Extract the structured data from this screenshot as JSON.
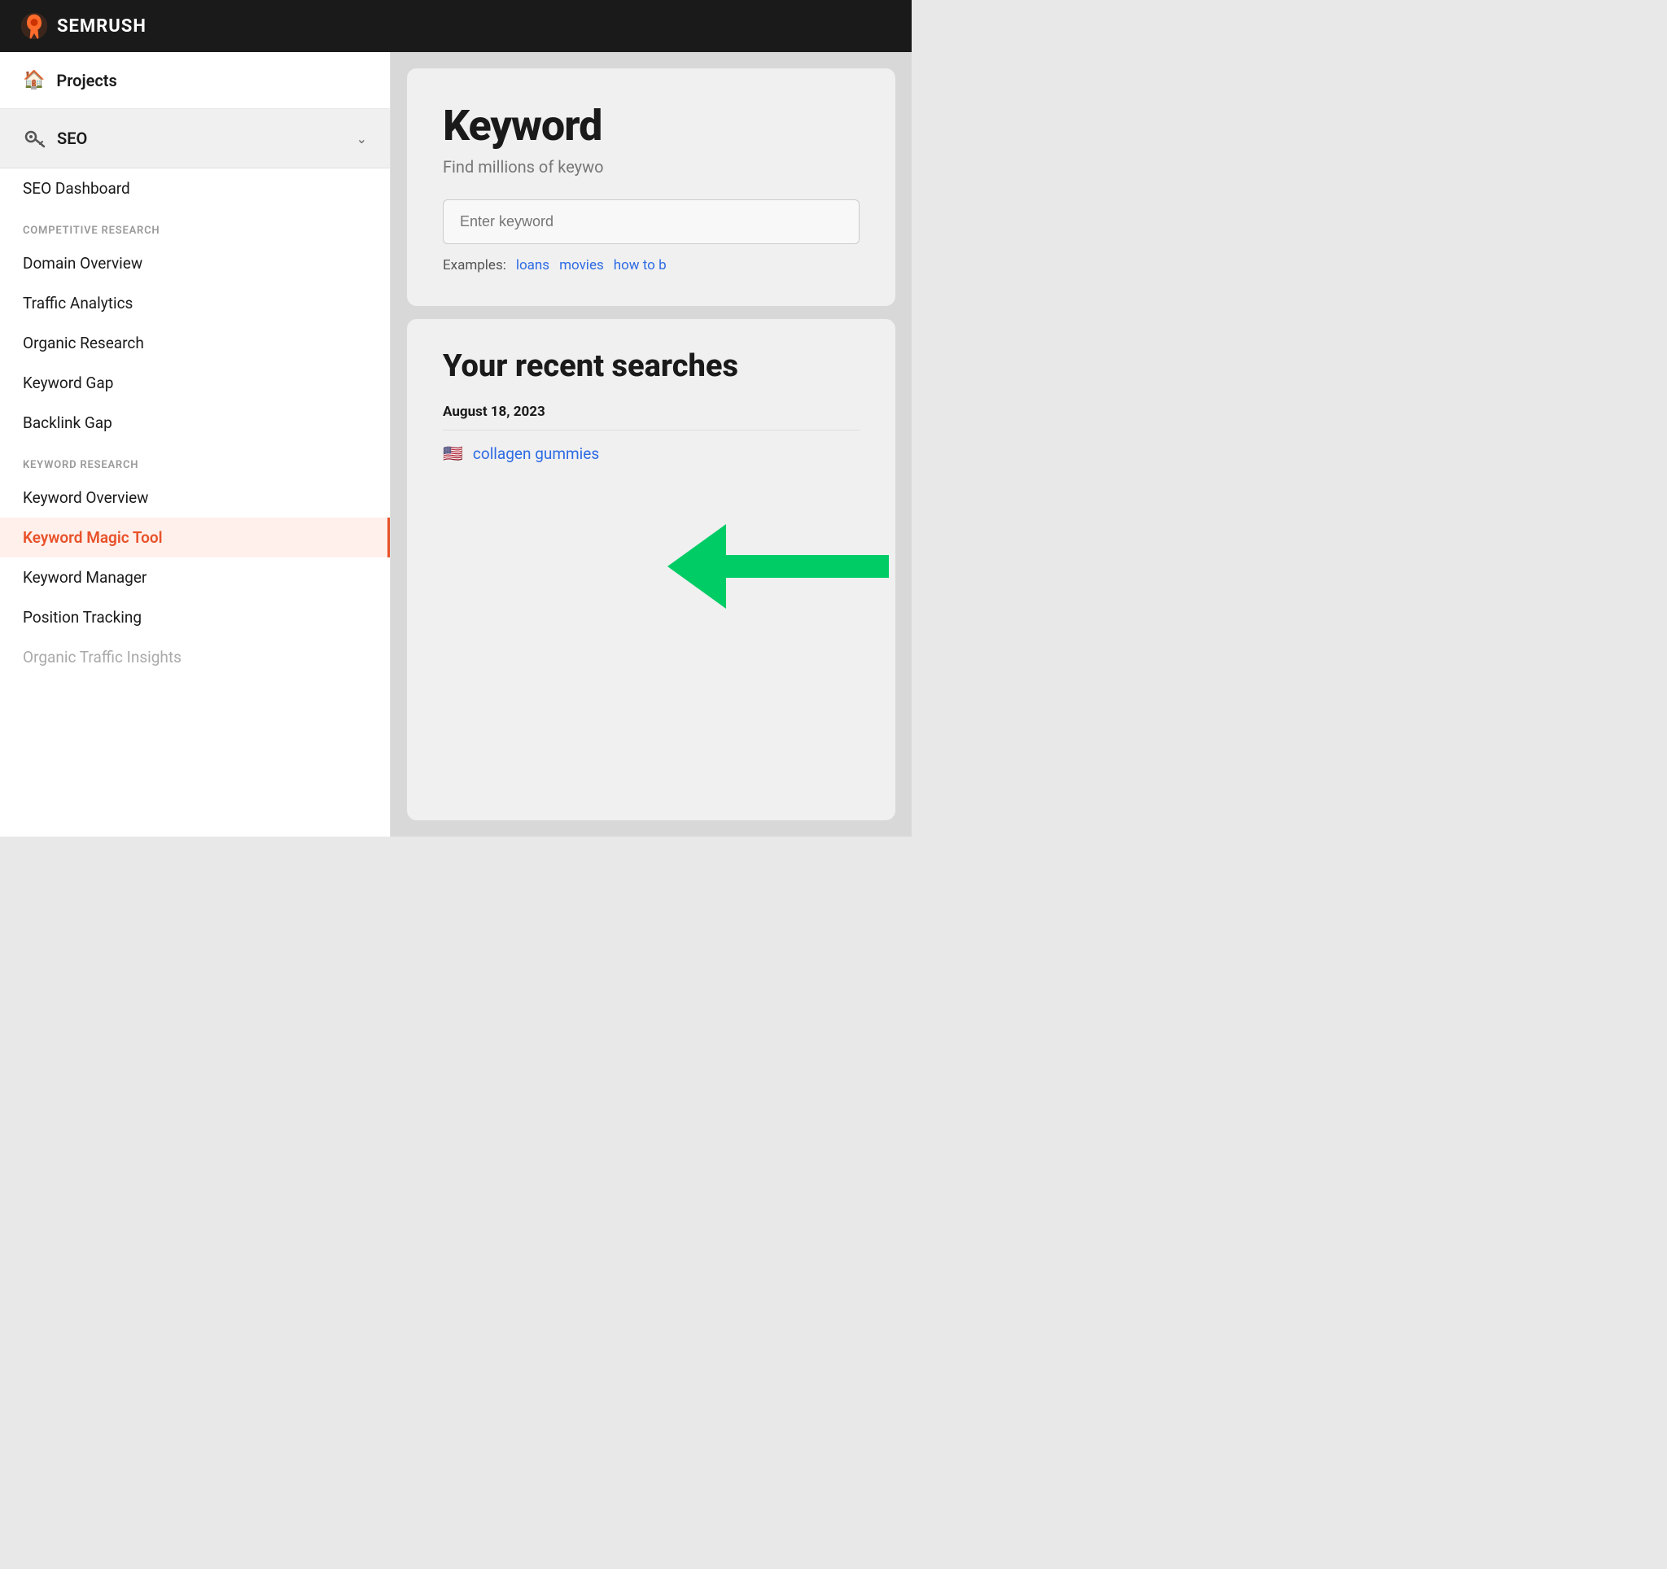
{
  "header": {
    "logo_text": "SEMRUSH"
  },
  "sidebar": {
    "projects_label": "Projects",
    "seo_label": "SEO",
    "nav_sections": [
      {
        "label": "",
        "items": [
          {
            "id": "seo-dashboard",
            "text": "SEO Dashboard",
            "active": false,
            "disabled": false
          }
        ]
      },
      {
        "label": "COMPETITIVE RESEARCH",
        "items": [
          {
            "id": "domain-overview",
            "text": "Domain Overview",
            "active": false,
            "disabled": false
          },
          {
            "id": "traffic-analytics",
            "text": "Traffic Analytics",
            "active": false,
            "disabled": false
          },
          {
            "id": "organic-research",
            "text": "Organic Research",
            "active": false,
            "disabled": false
          },
          {
            "id": "keyword-gap",
            "text": "Keyword Gap",
            "active": false,
            "disabled": false
          },
          {
            "id": "backlink-gap",
            "text": "Backlink Gap",
            "active": false,
            "disabled": false
          }
        ]
      },
      {
        "label": "KEYWORD RESEARCH",
        "items": [
          {
            "id": "keyword-overview",
            "text": "Keyword Overview",
            "active": false,
            "disabled": false
          },
          {
            "id": "keyword-magic-tool",
            "text": "Keyword Magic Tool",
            "active": true,
            "disabled": false
          },
          {
            "id": "keyword-manager",
            "text": "Keyword Manager",
            "active": false,
            "disabled": false
          },
          {
            "id": "position-tracking",
            "text": "Position Tracking",
            "active": false,
            "disabled": false
          },
          {
            "id": "organic-traffic-insights",
            "text": "Organic Traffic Insights",
            "active": false,
            "disabled": true
          }
        ]
      }
    ]
  },
  "main": {
    "keyword_card": {
      "title": "Keyword",
      "subtitle": "Find millions of keywo",
      "input_placeholder": "Enter keyword",
      "examples_label": "Examples:",
      "examples": [
        "loans",
        "movies",
        "how to b"
      ]
    },
    "recent_card": {
      "title": "Your recent searches",
      "date": "August 18, 2023",
      "searches": [
        {
          "flag": "🇺🇸",
          "text": "collagen gummies"
        }
      ]
    }
  }
}
